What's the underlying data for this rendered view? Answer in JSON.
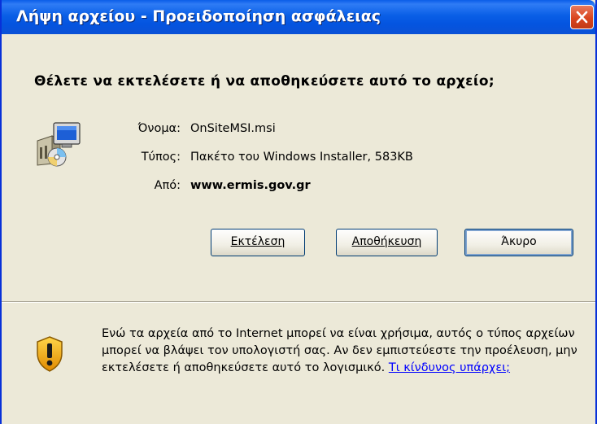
{
  "window": {
    "title": "Λήψη αρχείου - Προειδοποίηση ασφάλειας"
  },
  "prompt": {
    "question": "Θέλετε να εκτελέσετε ή να αποθηκεύσετε αυτό το αρχείο;"
  },
  "file": {
    "icon": "msi-installer-icon",
    "name_label": "Όνομα:",
    "name_value": "OnSiteMSI.msi",
    "type_label": "Τύπος:",
    "type_value": "Πακέτο του Windows Installer, 583KB",
    "from_label": "Από:",
    "from_value": "www.ermis.gov.gr"
  },
  "buttons": {
    "run_label": "Εκτέλεση",
    "save_label": "Αποθήκευση",
    "cancel_label": "Άκυρο"
  },
  "warning": {
    "icon": "security-shield-icon",
    "text": "Ενώ τα αρχεία από το Internet μπορεί να είναι χρήσιμα, αυτός ο τύπος αρχείων μπορεί να βλάψει τον υπολογιστή σας. Αν δεν εμπιστεύεστε την προέλευση, μην εκτελέσετε ή αποθηκεύσετε αυτό το λογισμικό.",
    "link_text": "Τι κίνδυνος υπάρχει;"
  },
  "colors": {
    "titlebar": "#0a5fe6",
    "close": "#d9451f",
    "link": "#0000ff",
    "background": "#ece9d8"
  }
}
